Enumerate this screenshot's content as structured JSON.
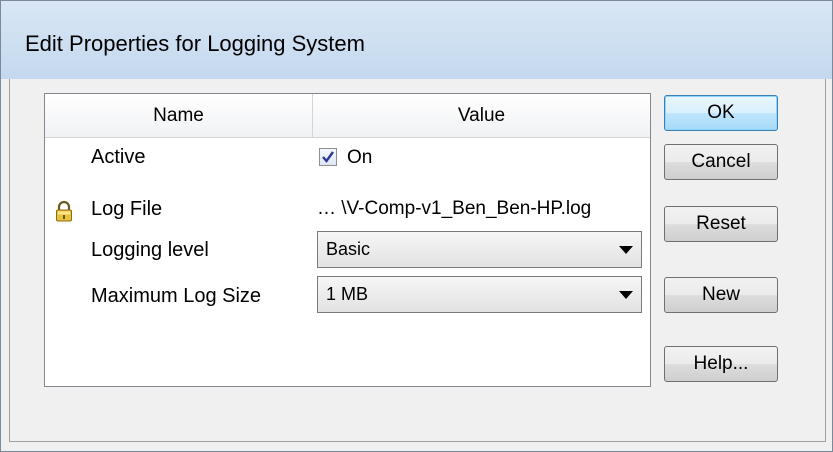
{
  "dialog": {
    "title": "Edit Properties for Logging System"
  },
  "table": {
    "columns": [
      "Name",
      "Value"
    ],
    "rows": [
      {
        "name": "Active",
        "value": "On",
        "type": "checkbox",
        "checked": true
      },
      {
        "name": "Log File",
        "value": "… \\V-Comp-v1_Ben_Ben-HP.log",
        "type": "readonly",
        "locked": true,
        "icon": "lock-icon"
      },
      {
        "name": "Logging level",
        "value": "Basic",
        "type": "dropdown"
      },
      {
        "name": "Maximum Log Size",
        "value": "1 MB",
        "type": "dropdown"
      }
    ]
  },
  "buttons": {
    "ok": "OK",
    "cancel": "Cancel",
    "reset": "Reset",
    "new": "New",
    "help": "Help..."
  }
}
